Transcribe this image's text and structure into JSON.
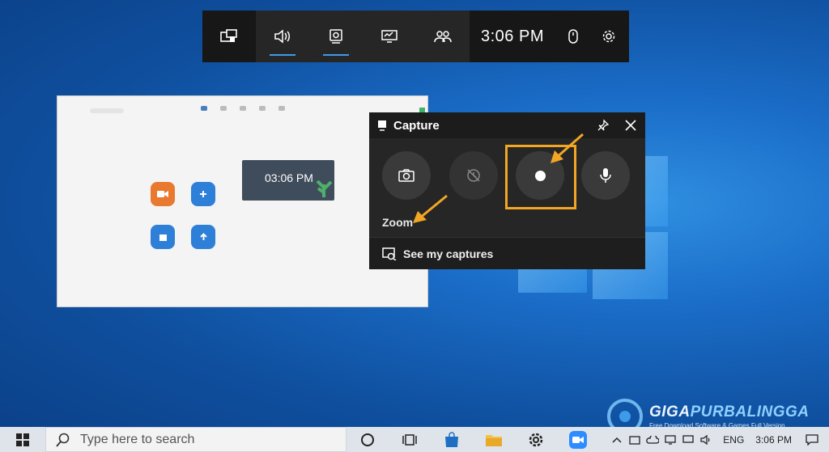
{
  "game_bar": {
    "time": "3:06 PM",
    "buttons": [
      "widget-menu-icon",
      "audio-icon",
      "capture-icon",
      "performance-icon",
      "social-icon"
    ]
  },
  "zoom_window": {
    "clock_time": "03:06 PM"
  },
  "capture_widget": {
    "title": "Capture",
    "target_app": "Zoom",
    "see_captures": "See my captures"
  },
  "watermark": {
    "title_part1": "GIGA",
    "title_part2": "PURBALINGGA",
    "subtitle": "Free Download Software & Games Full Version"
  },
  "taskbar": {
    "search_placeholder": "Type here to search",
    "language": "ENG",
    "time": "3:06 PM"
  },
  "colors": {
    "highlight": "#f2a623",
    "accent": "#3d9be9"
  }
}
